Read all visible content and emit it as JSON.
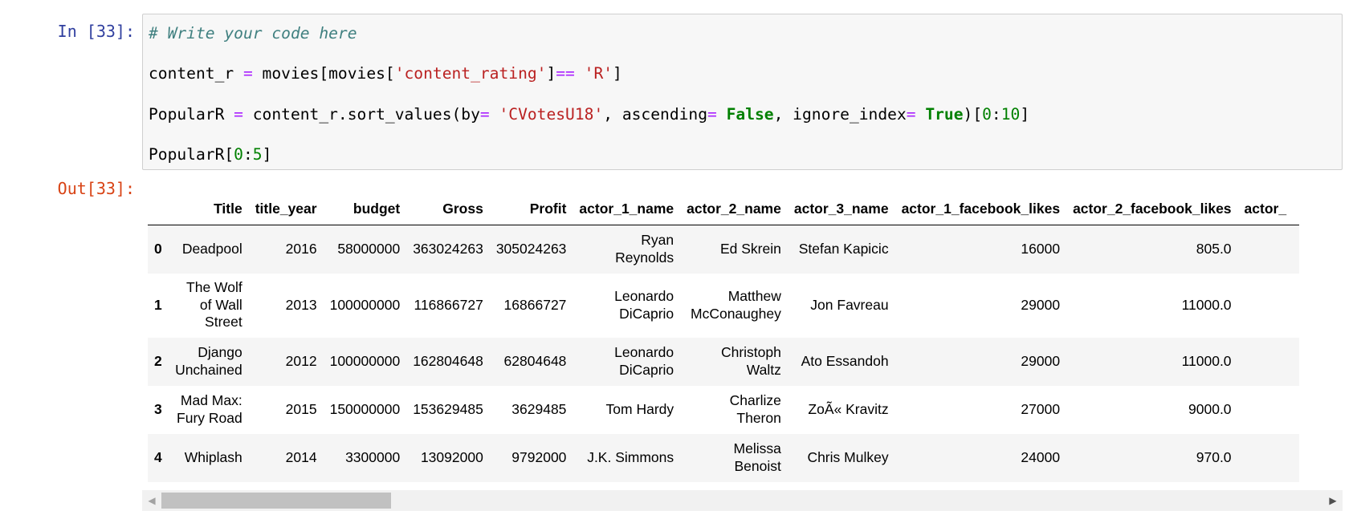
{
  "cell": {
    "in_prompt": "In [33]:",
    "out_prompt": "Out[33]:",
    "code": {
      "line1": "# Write your code here",
      "line2": {
        "a": "content_r ",
        "b": "=",
        "c": " movies[movies[",
        "d": "'content_rating'",
        "e": "]",
        "f": "==",
        "g": " ",
        "h": "'R'",
        "i": "]"
      },
      "line3": {
        "a": "PopularR ",
        "b": "=",
        "c": " content_r.sort_values(by",
        "d": "=",
        "e": " ",
        "f": "'CVotesU18'",
        "g": ", ascending",
        "h": "=",
        "i": " ",
        "j": "False",
        "k": ", ignore_index",
        "l": "=",
        "m": " ",
        "n": "True",
        "o": ")[",
        "p": "0",
        "q": ":",
        "r": "10",
        "s": "]"
      },
      "line4": {
        "a": "PopularR[",
        "b": "0",
        "c": ":",
        "d": "5",
        "e": "]"
      }
    }
  },
  "table": {
    "columns": [
      "",
      "Title",
      "title_year",
      "budget",
      "Gross",
      "Profit",
      "actor_1_name",
      "actor_2_name",
      "actor_3_name",
      "actor_1_facebook_likes",
      "actor_2_facebook_likes",
      "actor_"
    ],
    "rows": [
      [
        "0",
        "Deadpool",
        "2016",
        "58000000",
        "363024263",
        "305024263",
        "Ryan Reynolds",
        "Ed Skrein",
        "Stefan Kapicic",
        "16000",
        "805.0",
        ""
      ],
      [
        "1",
        "The Wolf of Wall Street",
        "2013",
        "100000000",
        "116866727",
        "16866727",
        "Leonardo DiCaprio",
        "Matthew McConaughey",
        "Jon Favreau",
        "29000",
        "11000.0",
        ""
      ],
      [
        "2",
        "Django Unchained",
        "2012",
        "100000000",
        "162804648",
        "62804648",
        "Leonardo DiCaprio",
        "Christoph Waltz",
        "Ato Essandoh",
        "29000",
        "11000.0",
        ""
      ],
      [
        "3",
        "Mad Max: Fury Road",
        "2015",
        "150000000",
        "153629485",
        "3629485",
        "Tom Hardy",
        "Charlize Theron",
        "ZoÃ« Kravitz",
        "27000",
        "9000.0",
        ""
      ],
      [
        "4",
        "Whiplash",
        "2014",
        "3300000",
        "13092000",
        "9792000",
        "J.K. Simmons",
        "Melissa Benoist",
        "Chris Mulkey",
        "24000",
        "970.0",
        ""
      ]
    ]
  },
  "scrollbar": {
    "left_arrow": "◀",
    "right_arrow": "▶"
  }
}
